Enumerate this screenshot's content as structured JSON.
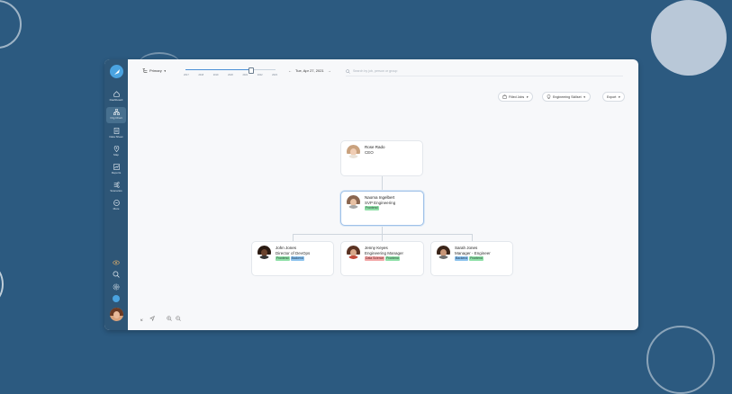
{
  "topbar": {
    "view_label": "Primary",
    "timeline_years": [
      "2017",
      "2018",
      "2019",
      "2020",
      "2021",
      "2022",
      "2023"
    ],
    "timeline_progress": 0.72,
    "date_label": "Tue, Apr 27, 2021",
    "search_placeholder": "Search by job, person or group"
  },
  "sidebar": {
    "items": [
      {
        "label": "Dashboard",
        "icon": "home-icon"
      },
      {
        "label": "Org Chart",
        "icon": "org-chart-icon",
        "active": true
      },
      {
        "label": "Data Sheet",
        "icon": "data-sheet-icon"
      },
      {
        "label": "Map",
        "icon": "map-pin-icon"
      },
      {
        "label": "Reports",
        "icon": "reports-icon"
      },
      {
        "label": "Scenarios",
        "icon": "scenarios-icon"
      },
      {
        "label": "More",
        "icon": "more-icon"
      }
    ]
  },
  "filters": {
    "filled_jobs": "Filled Jobs",
    "skillset": "Engineering Skillset",
    "export": "Export"
  },
  "org": {
    "root": {
      "name": "Rose Rado",
      "title": "CEO",
      "tags": []
    },
    "manager": {
      "name": "Naoma Ingelbert",
      "title": "SVP Engineering",
      "tags": [
        {
          "label": "Frontend",
          "type": "frontend"
        }
      ]
    },
    "reports": [
      {
        "name": "John Jones",
        "title": "Director of DevOps",
        "tags": [
          {
            "label": "Frontend",
            "type": "frontend"
          },
          {
            "label": "Backend",
            "type": "backend"
          }
        ]
      },
      {
        "name": "Jenny Keyes",
        "title": "Engineering Manager",
        "tags": [
          {
            "label": "Data Science",
            "type": "datascience"
          },
          {
            "label": "Frontend",
            "type": "frontend"
          }
        ]
      },
      {
        "name": "Sarah Jones",
        "title": "Manager - Engineer",
        "tags": [
          {
            "label": "Backend",
            "type": "backend"
          },
          {
            "label": "Frontend",
            "type": "frontend"
          }
        ]
      }
    ]
  },
  "colors": {
    "background": "#2c5a80",
    "sidebar": "#2e5677",
    "accent": "#4aa3e0",
    "selected_border": "#9fc1e8",
    "tag_frontend": "#8fe0a8",
    "tag_backend": "#8cc3ee",
    "tag_datascience": "#f3a8a8"
  }
}
